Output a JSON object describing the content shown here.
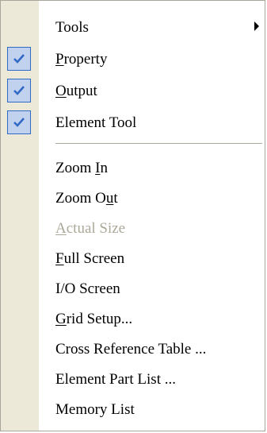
{
  "menu": {
    "items": [
      {
        "key": "tools",
        "pre": "Tools",
        "u": "",
        "post": "",
        "checked": false,
        "disabled": false,
        "has_submenu": true
      },
      {
        "key": "property",
        "pre": "",
        "u": "P",
        "post": "roperty",
        "checked": true,
        "disabled": false,
        "has_submenu": false
      },
      {
        "key": "output",
        "pre": "",
        "u": "O",
        "post": "utput",
        "checked": true,
        "disabled": false,
        "has_submenu": false
      },
      {
        "key": "element-tool",
        "pre": "Element Tool",
        "u": "",
        "post": "",
        "checked": true,
        "disabled": false,
        "has_submenu": false
      },
      {
        "key": "zoom-in",
        "pre": "Zoom ",
        "u": "I",
        "post": "n",
        "checked": false,
        "disabled": false,
        "has_submenu": false
      },
      {
        "key": "zoom-out",
        "pre": "Zoom O",
        "u": "u",
        "post": "t",
        "checked": false,
        "disabled": false,
        "has_submenu": false
      },
      {
        "key": "actual-size",
        "pre": "",
        "u": "A",
        "post": "ctual Size",
        "checked": false,
        "disabled": true,
        "has_submenu": false
      },
      {
        "key": "full-screen",
        "pre": "",
        "u": "F",
        "post": "ull Screen",
        "checked": false,
        "disabled": false,
        "has_submenu": false
      },
      {
        "key": "io-screen",
        "pre": "I/O Screen",
        "u": "",
        "post": "",
        "checked": false,
        "disabled": false,
        "has_submenu": false
      },
      {
        "key": "grid-setup",
        "pre": "",
        "u": "G",
        "post": "rid Setup...",
        "checked": false,
        "disabled": false,
        "has_submenu": false
      },
      {
        "key": "cross-reference-table",
        "pre": "Cross Reference Table ...",
        "u": "",
        "post": "",
        "checked": false,
        "disabled": false,
        "has_submenu": false
      },
      {
        "key": "element-part-list",
        "pre": "Element Part List ...",
        "u": "",
        "post": "",
        "checked": false,
        "disabled": false,
        "has_submenu": false
      },
      {
        "key": "memory-list",
        "pre": "Memory List",
        "u": "",
        "post": "",
        "checked": false,
        "disabled": false,
        "has_submenu": false
      }
    ],
    "icons": {
      "check": "checkmark-icon",
      "submenu": "submenu-arrow-icon"
    },
    "colors": {
      "gutter": "#ece9d8",
      "check_bg": "#c1d2ee",
      "check_border": "#316ac5",
      "check_mark": "#316ac5",
      "disabled_text": "#aca899",
      "separator": "#aca899"
    }
  }
}
